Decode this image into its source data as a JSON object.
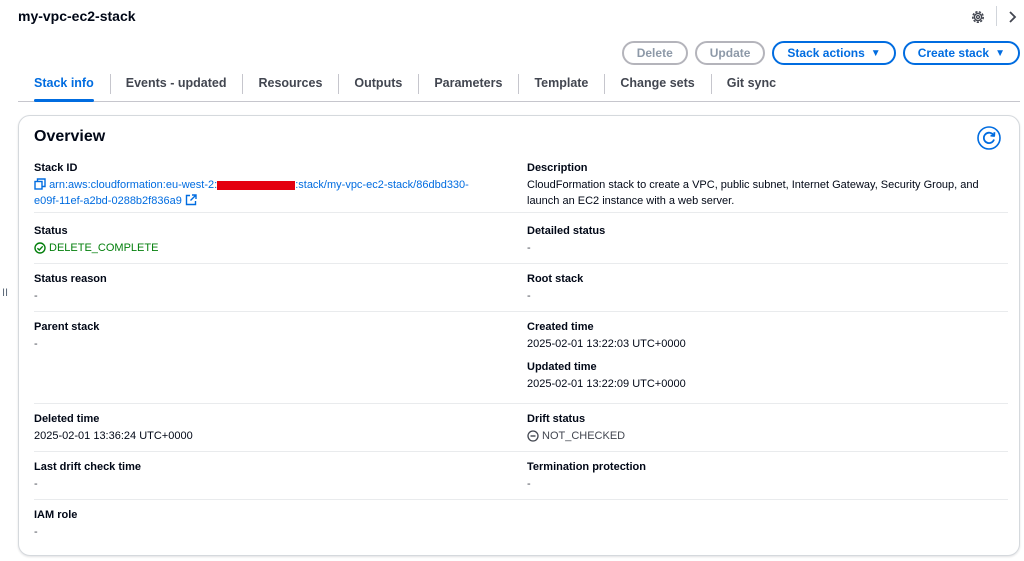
{
  "header": {
    "title": "my-vpc-ec2-stack",
    "settings_icon": "gear-icon",
    "nav_icon": "chevron-right-icon"
  },
  "actions": {
    "delete_label": "Delete",
    "update_label": "Update",
    "stack_actions_label": "Stack actions",
    "create_stack_label": "Create stack",
    "caret": "▼"
  },
  "tabs": [
    {
      "label": "Stack info",
      "active": true
    },
    {
      "label": "Events - updated",
      "active": false
    },
    {
      "label": "Resources",
      "active": false
    },
    {
      "label": "Outputs",
      "active": false
    },
    {
      "label": "Parameters",
      "active": false
    },
    {
      "label": "Template",
      "active": false
    },
    {
      "label": "Change sets",
      "active": false
    },
    {
      "label": "Git sync",
      "active": false
    }
  ],
  "side_handle": "II",
  "overview": {
    "title": "Overview",
    "stack_id": {
      "label": "Stack ID",
      "prefix": "arn:aws:cloudformation:eu-west-2:",
      "suffix": ":stack/my-vpc-ec2-stack/86dbd330-",
      "line2": "e09f-11ef-a2bd-0288b2f836a9"
    },
    "description": {
      "label": "Description",
      "value": "CloudFormation stack to create a VPC, public subnet, Internet Gateway, Security Group, and launch an EC2 instance with a web server."
    },
    "status": {
      "label": "Status",
      "value": "DELETE_COMPLETE"
    },
    "detailed_status": {
      "label": "Detailed status",
      "value": "-"
    },
    "status_reason": {
      "label": "Status reason",
      "value": "-"
    },
    "root_stack": {
      "label": "Root stack",
      "value": "-"
    },
    "parent_stack": {
      "label": "Parent stack",
      "value": "-"
    },
    "created_time": {
      "label": "Created time",
      "value": "2025-02-01 13:22:03 UTC+0000"
    },
    "updated_time": {
      "label": "Updated time",
      "value": "2025-02-01 13:22:09 UTC+0000"
    },
    "deleted_time": {
      "label": "Deleted time",
      "value": "2025-02-01 13:36:24 UTC+0000"
    },
    "drift_status": {
      "label": "Drift status",
      "value": "NOT_CHECKED"
    },
    "last_drift_check": {
      "label": "Last drift check time",
      "value": "-"
    },
    "termination_protection": {
      "label": "Termination protection",
      "value": "-"
    },
    "iam_role": {
      "label": "IAM role",
      "value": "-"
    }
  },
  "colors": {
    "accent": "#006ce0",
    "success": "#037f0c",
    "redaction": "#e4000f"
  }
}
